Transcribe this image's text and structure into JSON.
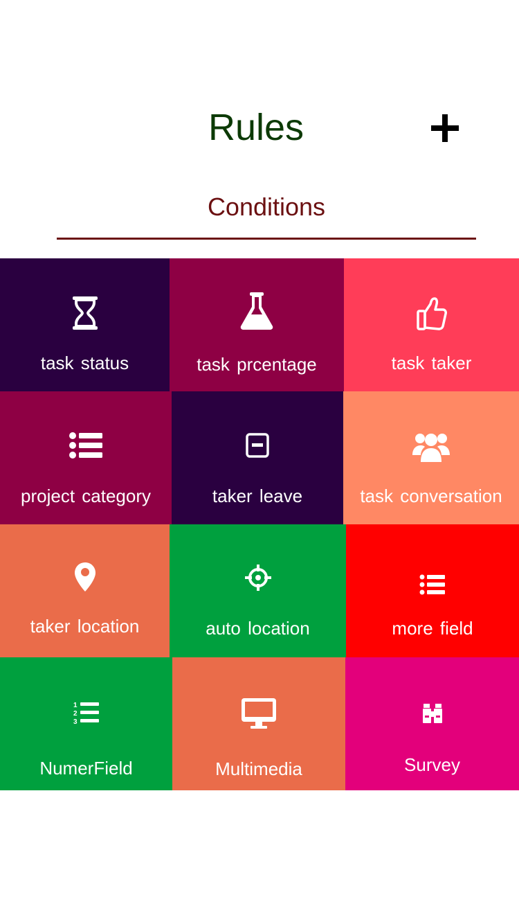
{
  "header": {
    "title": "Rules",
    "add_icon": "plus-icon"
  },
  "section": {
    "title": "Conditions",
    "underline_color": "#6b1011"
  },
  "tiles": [
    {
      "label": "task  status",
      "icon": "hourglass-icon",
      "color": "#2a0040"
    },
    {
      "label": "task  prcentage",
      "icon": "flask-icon",
      "color": "#8e0044"
    },
    {
      "label": "task  taker",
      "icon": "thumbs-up-icon",
      "color": "#ff3d58"
    },
    {
      "label": "project  category",
      "icon": "list-icon",
      "color": "#8e0044"
    },
    {
      "label": "taker  leave",
      "icon": "minus-square-icon",
      "color": "#2a0040"
    },
    {
      "label": "task  conversation",
      "icon": "users-icon",
      "color": "#ff8864"
    },
    {
      "label": "taker  location",
      "icon": "map-marker-icon",
      "color": "#ea6c4a"
    },
    {
      "label": "auto  location",
      "icon": "crosshairs-icon",
      "color": "#00a03e"
    },
    {
      "label": "more  field",
      "icon": "list-icon",
      "color": "#ff0000"
    },
    {
      "label": "NumerField",
      "icon": "numbered-list-icon",
      "color": "#00a03e"
    },
    {
      "label": "Multimedia",
      "icon": "desktop-icon",
      "color": "#ea6c4a"
    },
    {
      "label": "Survey",
      "icon": "binoculars-icon",
      "color": "#e3007b"
    }
  ]
}
